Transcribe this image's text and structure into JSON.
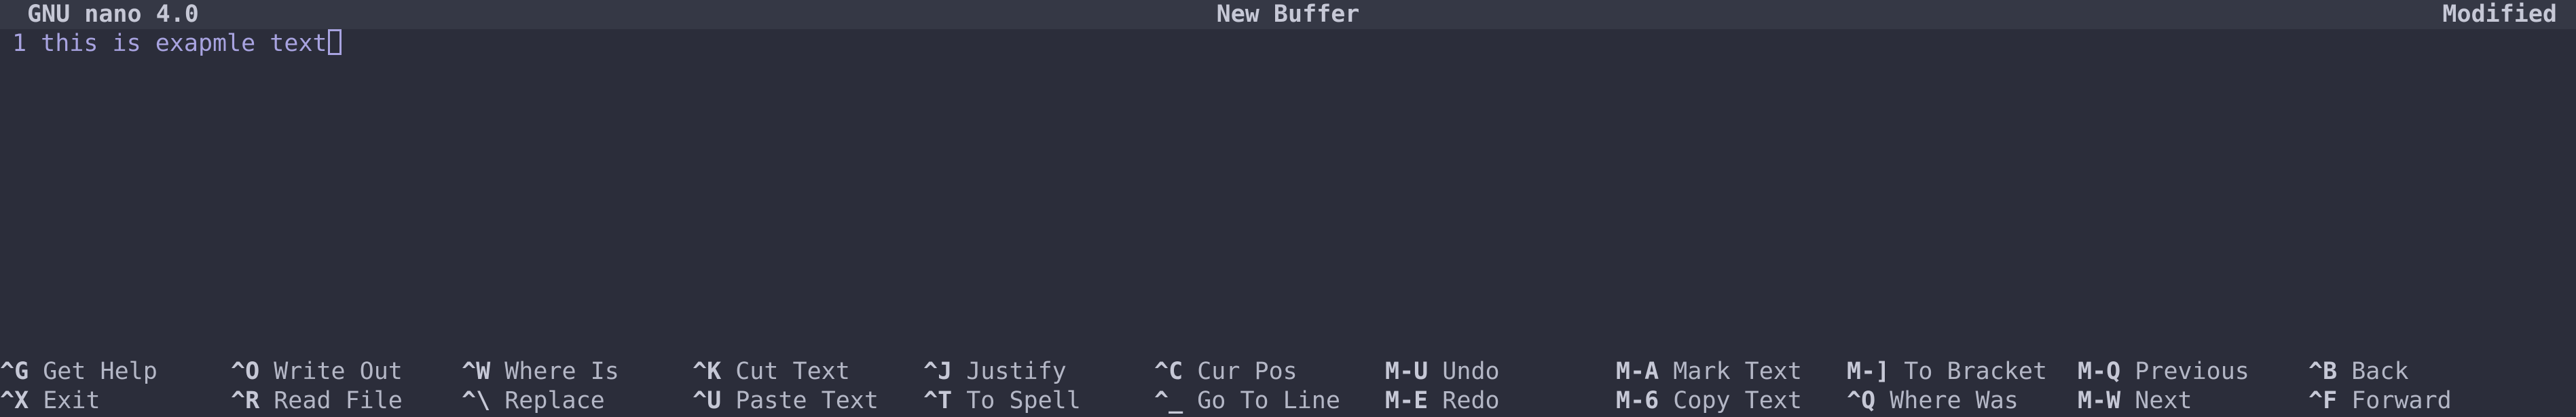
{
  "titlebar": {
    "app_version": "GNU nano 4.0",
    "buffer_name": "New Buffer",
    "status": "Modified"
  },
  "editor": {
    "lines": [
      {
        "number": "1",
        "text": "this is exapmle text"
      }
    ]
  },
  "shortcuts": {
    "row1": [
      {
        "key": "^G",
        "label": "Get Help"
      },
      {
        "key": "^O",
        "label": "Write Out"
      },
      {
        "key": "^W",
        "label": "Where Is"
      },
      {
        "key": "^K",
        "label": "Cut Text"
      },
      {
        "key": "^J",
        "label": "Justify"
      },
      {
        "key": "^C",
        "label": "Cur Pos"
      },
      {
        "key": "M-U",
        "label": "Undo"
      },
      {
        "key": "M-A",
        "label": "Mark Text"
      },
      {
        "key": "M-]",
        "label": "To Bracket"
      },
      {
        "key": "M-Q",
        "label": "Previous"
      },
      {
        "key": "^B",
        "label": "Back"
      }
    ],
    "row2": [
      {
        "key": "^X",
        "label": "Exit"
      },
      {
        "key": "^R",
        "label": "Read File"
      },
      {
        "key": "^\\",
        "label": "Replace"
      },
      {
        "key": "^U",
        "label": "Paste Text"
      },
      {
        "key": "^T",
        "label": "To Spell"
      },
      {
        "key": "^_",
        "label": "Go To Line"
      },
      {
        "key": "M-E",
        "label": "Redo"
      },
      {
        "key": "M-6",
        "label": "Copy Text"
      },
      {
        "key": "^Q",
        "label": "Where Was"
      },
      {
        "key": "M-W",
        "label": "Next"
      },
      {
        "key": "^F",
        "label": "Forward"
      }
    ]
  }
}
